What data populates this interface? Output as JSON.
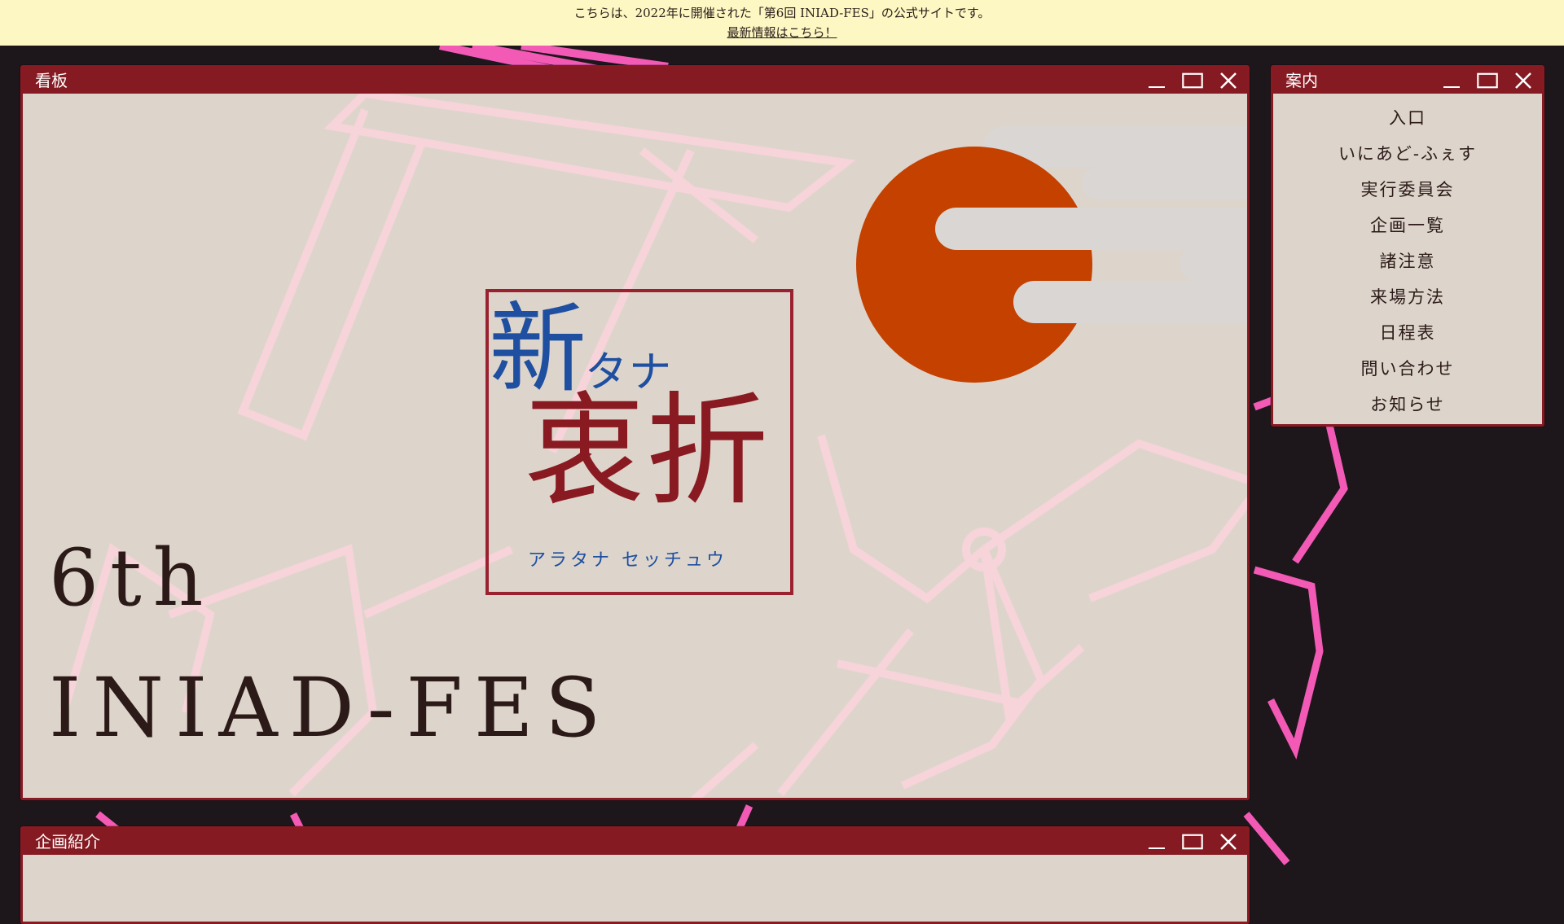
{
  "notice": {
    "text": "こちらは、2022年に開催された「第6回 INIAD-FES」の公式サイトです。",
    "link": "最新情報はこちら！"
  },
  "main_window": {
    "title": "看板",
    "heading_line1": "6th",
    "heading_line2": "INIAD-FES",
    "logo": {
      "kanji_top": "新",
      "kana_top": "タナ",
      "kanji_bottom": "衷折",
      "reading": "アラタナ セッチュウ"
    }
  },
  "side_window": {
    "title": "案内",
    "items": [
      "入口",
      "いにあど-ふぇす",
      "実行委員会",
      "企画一覧",
      "諸注意",
      "来場方法",
      "日程表",
      "問い合わせ",
      "お知らせ"
    ]
  },
  "bottom_window": {
    "title": "企画紹介"
  },
  "icons": {
    "minimize": "minimize-icon",
    "maximize": "maximize-icon",
    "close": "close-icon"
  },
  "colors": {
    "titlebar": "#861a22",
    "window_bg": "#ddd5cb",
    "page_bg": "#1d161b",
    "notice_bg": "#fdf7c3",
    "sun": "#c44100",
    "logo_blue": "#1e4fa0",
    "logo_red": "#8a1a22",
    "accent_pink": "#f25ab5"
  }
}
